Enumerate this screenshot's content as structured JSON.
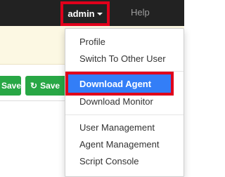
{
  "navbar": {
    "admin_label": "admin",
    "help_label": "Help"
  },
  "toolbar": {
    "save_label": "Save",
    "save_with_icon_label": "Save"
  },
  "admin_menu": {
    "profile": "Profile",
    "switch_user": "Switch To Other User",
    "download_agent": "Download Agent",
    "download_monitor": "Download Monitor",
    "user_management": "User Management",
    "agent_management": "Agent Management",
    "script_console": "Script Console"
  },
  "colors": {
    "navbar_bg": "#222222",
    "highlight_border": "#e0001b",
    "active_item_bg": "#337ef7",
    "save_button_bg": "#28a745",
    "notice_bg": "#fcf8e3"
  }
}
